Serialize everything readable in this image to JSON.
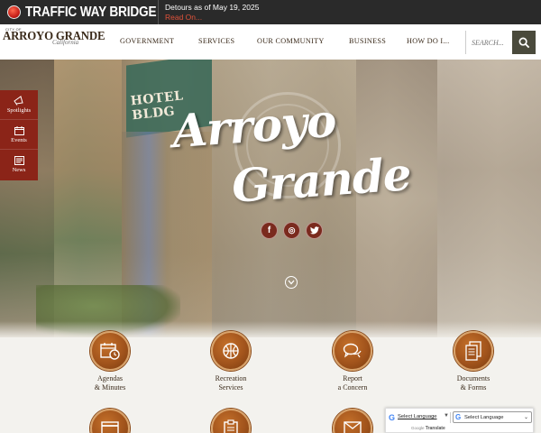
{
  "alert": {
    "title": "TRAFFIC WAY BRIDGE",
    "date": "Detours as of May 19, 2025",
    "link": "Read On..."
  },
  "logo": {
    "city_of": "CITY OF",
    "name": "ARROYO GRANDE",
    "state": "California"
  },
  "nav": {
    "items": [
      "GOVERNMENT",
      "SERVICES",
      "OUR COMMUNITY",
      "BUSINESS",
      "HOW DO I..."
    ]
  },
  "search": {
    "placeholder": "SEARCH..."
  },
  "hero": {
    "title_line1": "Arroyo",
    "title_line2": "Grande",
    "sign_text": "HOTEL BLDG"
  },
  "side": {
    "items": [
      "Spotlights",
      "Events",
      "News"
    ]
  },
  "social": {
    "facebook": "f",
    "instagram": "◎",
    "twitter": "t"
  },
  "quick_links": [
    {
      "line1": "Agendas",
      "line2": "& Minutes",
      "icon": "calendar-clock-icon"
    },
    {
      "line1": "Recreation",
      "line2": "Services",
      "icon": "basketball-icon"
    },
    {
      "line1": "Report",
      "line2": "a Concern",
      "icon": "chat-bubbles-icon"
    },
    {
      "line1": "Documents",
      "line2": "& Forms",
      "icon": "documents-icon"
    },
    {
      "line1": "",
      "line2": "",
      "icon": "payment-icon"
    },
    {
      "line1": "",
      "line2": "",
      "icon": "clipboard-icon"
    },
    {
      "line1": "",
      "line2": "",
      "icon": "envelope-icon"
    },
    {
      "line1": "",
      "line2": "",
      "icon": "map-icon"
    }
  ],
  "translate": {
    "link_text": "Select Language",
    "select_text": "Select Language",
    "powered_by": "Google",
    "translate_word": "Translate"
  }
}
